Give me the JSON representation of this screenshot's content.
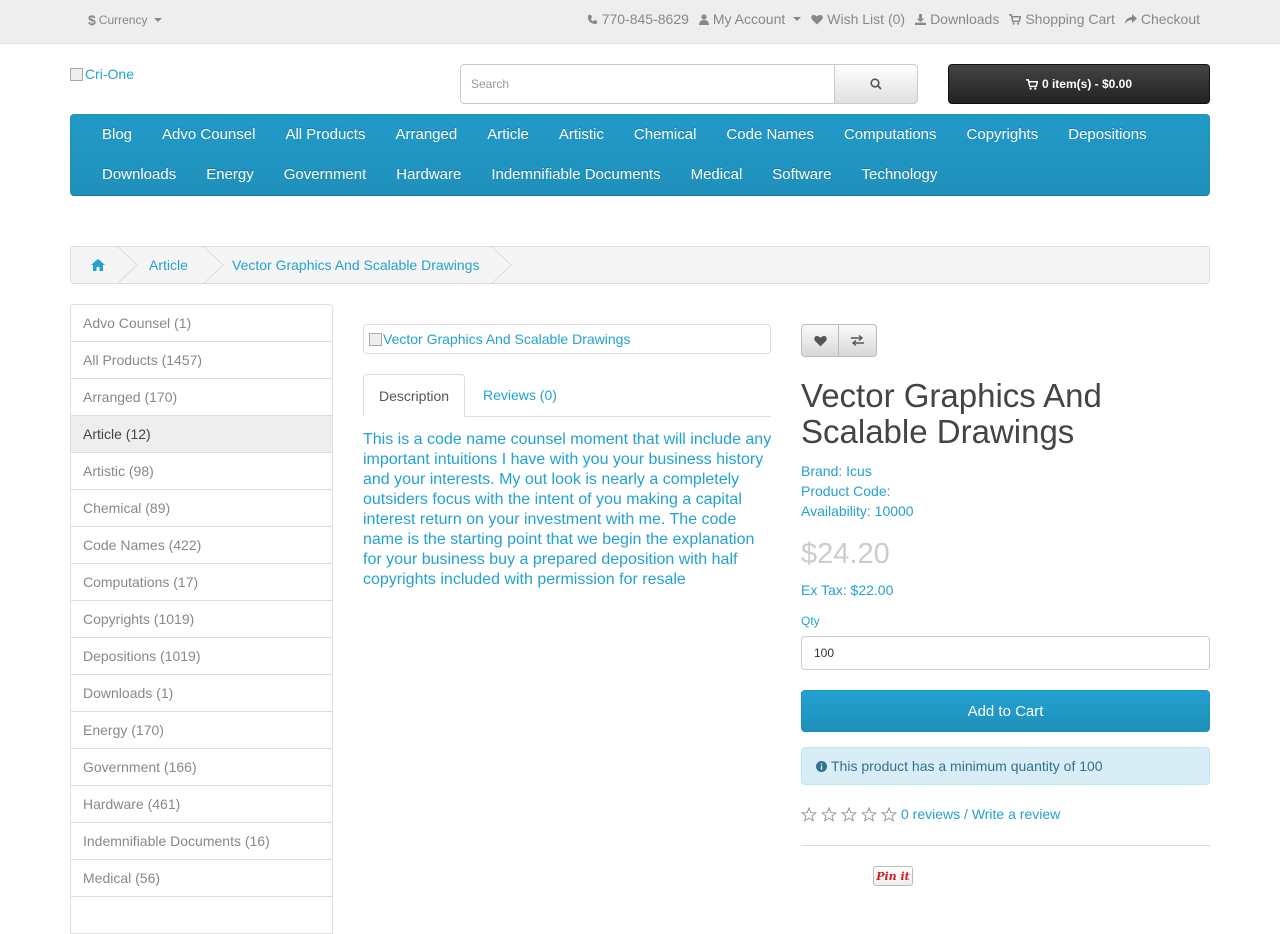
{
  "topbar": {
    "currency": "Currency",
    "phone": "770-845-8629",
    "my_account": "My Account",
    "wishlist": "Wish List (0)",
    "downloads": "Downloads",
    "shopping_cart": "Shopping Cart",
    "checkout": "Checkout"
  },
  "header": {
    "logo_alt": "Cri-One",
    "search_placeholder": "Search",
    "cart": "0 item(s) - $0.00"
  },
  "menu": {
    "row1": [
      "Blog",
      "Advo Counsel",
      "All Products",
      "Arranged",
      "Article",
      "Artistic",
      "Chemical",
      "Code Names",
      "Computations",
      "Copyrights",
      "Depositions"
    ],
    "row2": [
      "Downloads",
      "Energy",
      "Government",
      "Hardware",
      "Indemnifiable Documents",
      "Medical",
      "Software",
      "Technology"
    ]
  },
  "breadcrumb": {
    "items": [
      "Article",
      "Vector Graphics And Scalable Drawings"
    ]
  },
  "sidebar": {
    "categories": [
      "Advo Counsel (1)",
      "All Products (1457)",
      "Arranged (170)",
      "Article (12)",
      "Artistic (98)",
      "Chemical (89)",
      "Code Names (422)",
      "Computations (17)",
      "Copyrights (1019)",
      "Depositions (1019)",
      "Downloads (1)",
      "Energy (170)",
      "Government (166)",
      "Hardware (461)",
      "Indemnifiable Documents (16)",
      "Medical (56)",
      ""
    ],
    "active_index": 3
  },
  "product": {
    "image_alt": "Vector Graphics And Scalable Drawings",
    "tab_description": "Description",
    "tab_reviews": "Reviews (0)",
    "description": "This is a code name counsel moment that will include any important intuitions I have with you your business history and your interests. My out look is nearly a completely outsiders focus with the intent of you making a capital interest return on your investment with me. The code name is the starting point that we begin the explanation for your business buy a prepared deposition with half copyrights included with permission for resale",
    "title": "Vector Graphics And Scalable Drawings",
    "brand_label": "Brand: ",
    "brand": "Icus",
    "code": "Product Code:",
    "availability": "Availability: 10000",
    "price": "$24.20",
    "ex_tax": "Ex Tax: $22.00",
    "qty_label": "Qty",
    "qty": "100",
    "add_to_cart": "Add to Cart",
    "min_qty_alert": "This product has a minimum quantity of 100",
    "reviews_link": "0 reviews",
    "separator": " / ",
    "write_review": "Write a review",
    "rating_stars": 0,
    "pin_label": "Pin it"
  },
  "colors": {
    "brand_blue": "#229ac8",
    "link": "#23a1d1",
    "alert_bg": "#d9edf7"
  }
}
